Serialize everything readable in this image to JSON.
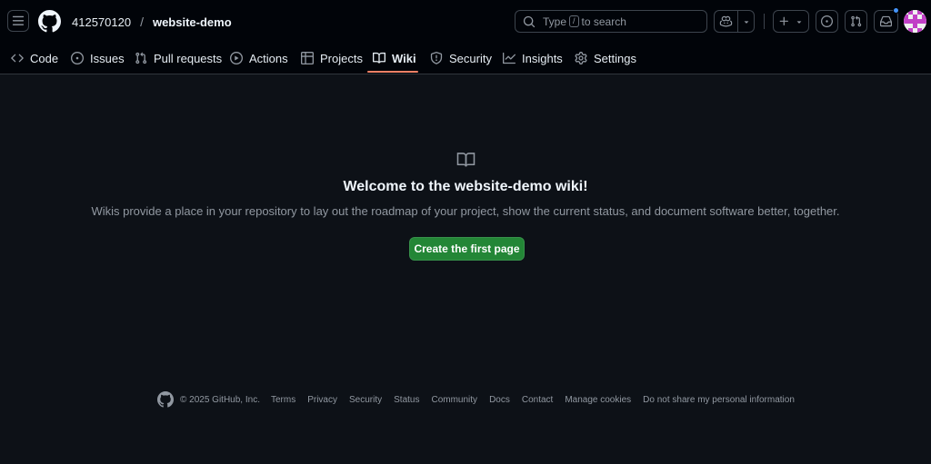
{
  "header": {
    "owner": "412570120",
    "separator": "/",
    "repo": "website-demo",
    "search": {
      "prefix": "Type",
      "key": "/",
      "suffix": "to search"
    },
    "icons": {
      "menu": "hamburger-icon",
      "logo": "github-mark-icon",
      "copilot": "copilot-icon",
      "new": "plus-icon",
      "issues": "issue-opened-icon",
      "pulls": "git-pull-request-icon",
      "inbox": "inbox-icon"
    },
    "notification_color": "#4493f8"
  },
  "nav": {
    "tabs": [
      {
        "label": "Code",
        "icon": "code-icon"
      },
      {
        "label": "Issues",
        "icon": "issue-opened-icon"
      },
      {
        "label": "Pull requests",
        "icon": "git-pull-request-icon"
      },
      {
        "label": "Actions",
        "icon": "play-icon"
      },
      {
        "label": "Projects",
        "icon": "table-icon"
      },
      {
        "label": "Wiki",
        "icon": "book-icon",
        "active": true
      },
      {
        "label": "Security",
        "icon": "shield-icon"
      },
      {
        "label": "Insights",
        "icon": "graph-icon"
      },
      {
        "label": "Settings",
        "icon": "gear-icon"
      }
    ],
    "active_underline_color": "#f78166"
  },
  "main": {
    "icon": "book-icon",
    "title": "Welcome to the website-demo wiki!",
    "description": "Wikis provide a place in your repository to lay out the roadmap of your project, show the current status, and document software better, together.",
    "button": "Create the first page",
    "button_color": "#238636"
  },
  "footer": {
    "copyright": "© 2025 GitHub, Inc.",
    "links": [
      "Terms",
      "Privacy",
      "Security",
      "Status",
      "Community",
      "Docs",
      "Contact",
      "Manage cookies",
      "Do not share my personal information"
    ]
  }
}
